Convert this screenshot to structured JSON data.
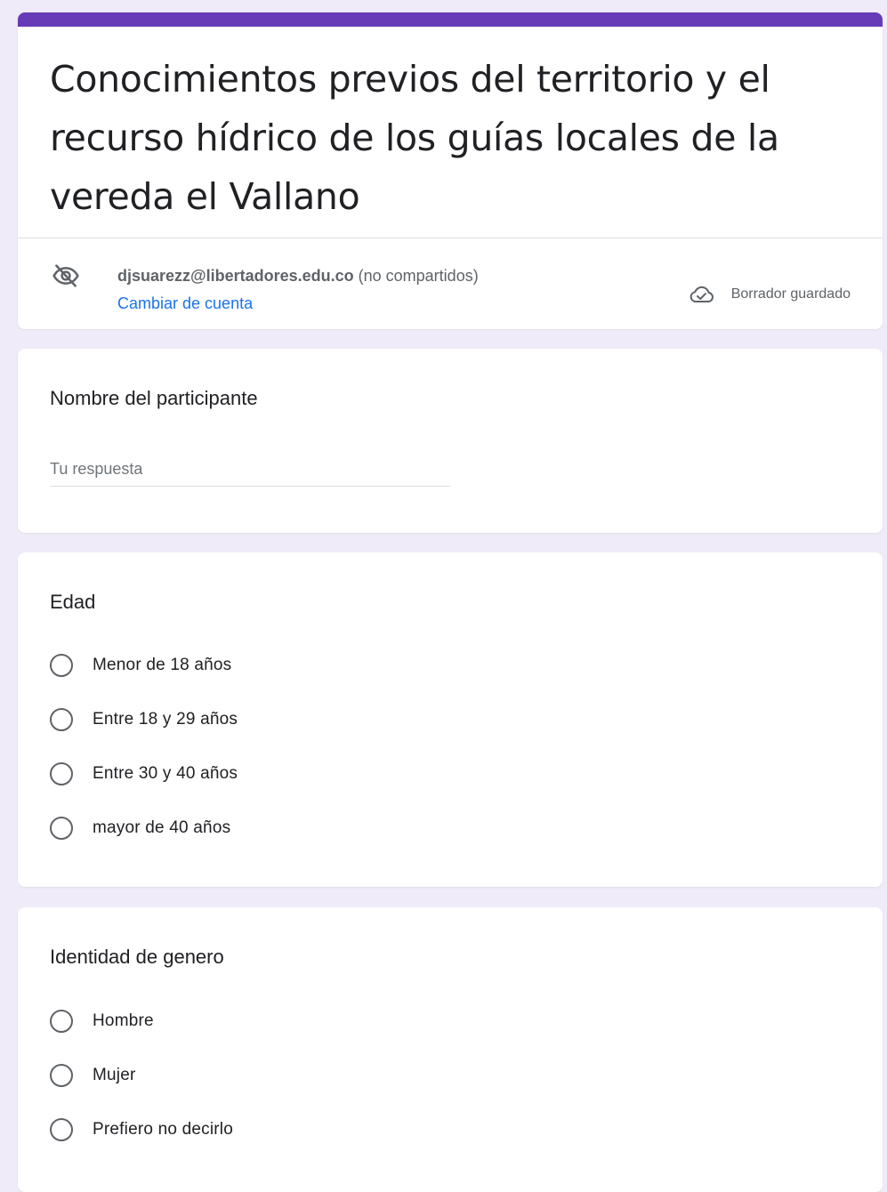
{
  "form": {
    "title": "Conocimientos previos del territorio y el recurso hídrico de los guías locales de la vereda el Vallano",
    "accent_color": "#673ab7",
    "background_color": "#f0ebf8"
  },
  "account": {
    "email": "djsuarezz@libertadores.edu.co",
    "sharing_note": "(no compartidos)",
    "switch_label": "Cambiar de cuenta",
    "icon": "eye-off-icon"
  },
  "status": {
    "label": "Borrador guardado",
    "icon": "cloud-done-icon"
  },
  "questions": [
    {
      "title": "Nombre del participante",
      "type": "short-answer",
      "placeholder": "Tu respuesta"
    },
    {
      "title": "Edad",
      "type": "multiple-choice",
      "options": [
        "Menor de 18 años",
        "Entre 18 y 29 años",
        "Entre 30 y 40 años",
        "mayor de 40 años"
      ]
    },
    {
      "title": "Identidad de genero",
      "type": "multiple-choice",
      "options": [
        "Hombre",
        "Mujer",
        "Prefiero no decirlo"
      ]
    }
  ]
}
